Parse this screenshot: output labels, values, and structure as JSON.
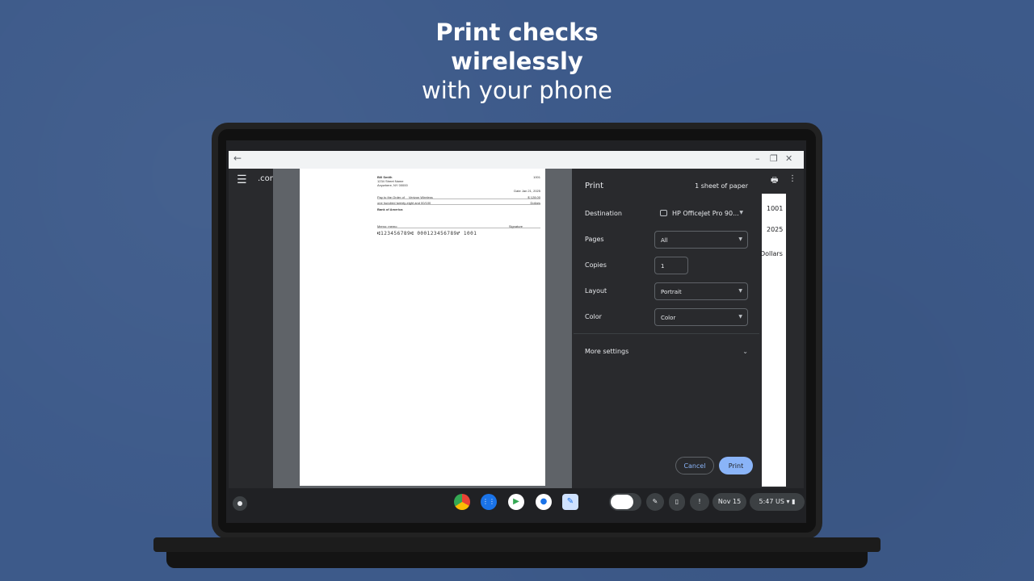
{
  "headline": {
    "line1": "Print checks",
    "line2": "wirelessly",
    "line3": "with your phone"
  },
  "window": {
    "url": ".com.",
    "bg_number": "1001",
    "bg_year": "2025",
    "bg_dollars": "Dollars"
  },
  "check": {
    "name": "Bill Smith",
    "address1": "1234 Street Name",
    "address2": "Anywhere, NY 00000",
    "number": "1001",
    "date_label": "Date",
    "date": "Jan 21, 2025",
    "pay_label": "Pay to the Order of",
    "payee": "Verizon Wireless",
    "amount": "$ 128.00",
    "amount_words": "one hundred twenty-eight and 00/100",
    "dollars": "Dollars",
    "bank": "Bank of America",
    "memo": "Memo: memo",
    "signature": "Signature",
    "micr": "⑆123456789⑆ 000123456789⑈ 1001"
  },
  "print_dialog": {
    "title": "Print",
    "sheets": "1 sheet of paper",
    "destination_label": "Destination",
    "destination_value": "HP OfficeJet Pro 90...",
    "pages_label": "Pages",
    "pages_value": "All",
    "copies_label": "Copies",
    "copies_value": "1",
    "layout_label": "Layout",
    "layout_value": "Portrait",
    "color_label": "Color",
    "color_value": "Color",
    "more_settings": "More settings",
    "cancel": "Cancel",
    "print": "Print"
  },
  "shelf": {
    "date": "Nov 15",
    "time": "5:47",
    "locale": "US"
  },
  "icons": {
    "menu": "hamburger-menu-icon",
    "printer": "printer-icon",
    "more": "more-vert-icon"
  }
}
